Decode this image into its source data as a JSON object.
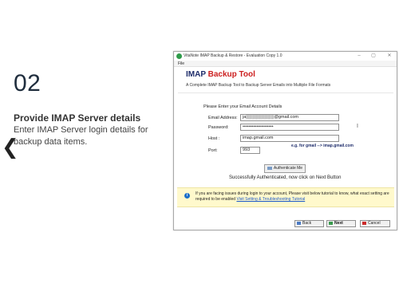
{
  "slide": {
    "nav_arrow": "❮",
    "step_number": "02",
    "step_title": "Provide IMAP Server details",
    "step_description": "Enter IMAP Server login details for backup data items."
  },
  "window": {
    "title": "VitaNote IMAP Backup & Restore - Evaluation Copy 1.0",
    "controls": {
      "minimize": "–",
      "maximize": "▢",
      "close": "✕"
    },
    "menu": {
      "file": "File"
    },
    "app_title_part1": "IMAP ",
    "app_title_part2": "Backup Tool",
    "app_subtitle": "A Complete IMAP Backup Tool to Backup Server Emails into Multiple File Formats",
    "form": {
      "heading": "Please Enter your Email Account Details",
      "email_label": "Email Address:",
      "email_value": "ja▒▒▒▒▒▒▒▒▒@gmail.com",
      "password_label": "Password:",
      "password_value": "••••••••••••••••••••",
      "host_label": "Host :",
      "host_value": "imap.gmail.com",
      "host_hint": "e.g. for gmail --> imap.gmail.com",
      "port_label": "Port:",
      "port_value": "993"
    },
    "authenticate_button": "Authenticate Me",
    "success_message": "Successfully Authenticated, now click on Next Button",
    "info": {
      "text": "If you are facing issues during login to your account, Please visit below tutorial to know, what exact setting are required to be enabled",
      "link": "Visit Setting & Troubleshooting Tutorial"
    },
    "buttons": {
      "back": "Back",
      "next": "Next",
      "cancel": "Cancel"
    }
  },
  "colors": {
    "brand_blue": "#1f2d6b",
    "brand_red": "#cc1f1f",
    "info_background": "#fff9cc",
    "link": "#1b58c9"
  }
}
